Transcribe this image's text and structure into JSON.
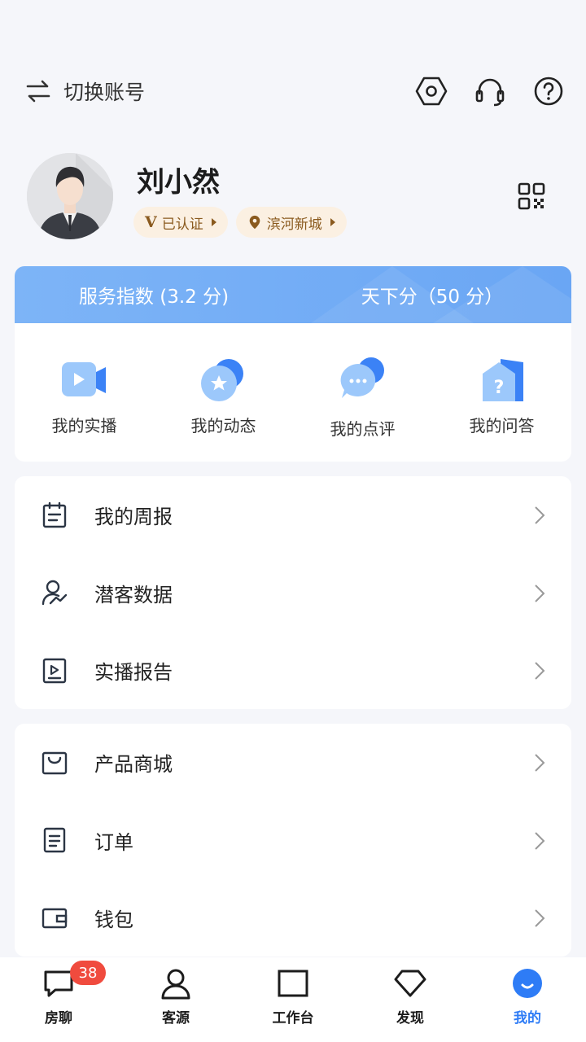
{
  "header": {
    "switch_label": "切换账号",
    "icons": [
      "settings-icon",
      "headset-icon",
      "help-icon"
    ]
  },
  "profile": {
    "name": "刘小然",
    "verified_label": "已认证",
    "location_label": "滨河新城",
    "verified_mark": "V"
  },
  "scores": {
    "service_index": "服务指数 (3.2 分)",
    "tianxia_score": "天下分（50 分）"
  },
  "quick_actions": [
    {
      "label": "我的实播",
      "icon": "video-icon"
    },
    {
      "label": "我的动态",
      "icon": "star-bubble-icon"
    },
    {
      "label": "我的点评",
      "icon": "comment-icon"
    },
    {
      "label": "我的问答",
      "icon": "question-house-icon"
    }
  ],
  "list_group_1": [
    {
      "label": "我的周报",
      "icon": "calendar-icon"
    },
    {
      "label": "潜客数据",
      "icon": "user-trend-icon"
    },
    {
      "label": "实播报告",
      "icon": "play-report-icon"
    }
  ],
  "list_group_2": [
    {
      "label": "产品商城",
      "icon": "bag-icon"
    },
    {
      "label": "订单",
      "icon": "order-icon"
    },
    {
      "label": "钱包",
      "icon": "wallet-icon"
    }
  ],
  "nav": {
    "items": [
      {
        "label": "房聊",
        "badge": "38"
      },
      {
        "label": "客源"
      },
      {
        "label": "工作台"
      },
      {
        "label": "发现"
      },
      {
        "label": "我的"
      }
    ],
    "active_color": "#2e7cf6"
  }
}
